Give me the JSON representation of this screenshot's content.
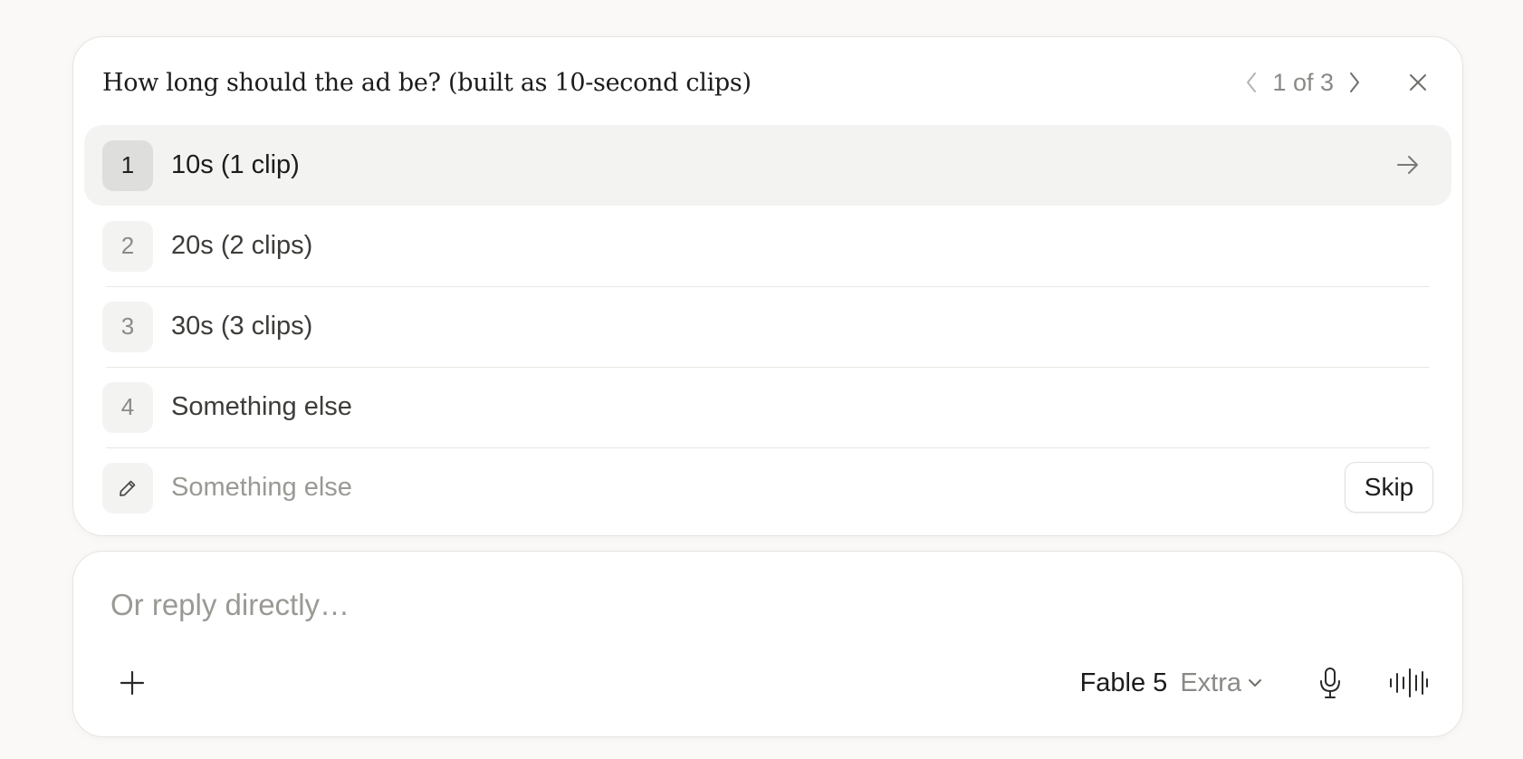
{
  "question": {
    "title": "How long should the ad be? (built as 10-second clips)",
    "pager": "1 of 3"
  },
  "options": [
    {
      "number": "1",
      "label": "10s (1 clip)"
    },
    {
      "number": "2",
      "label": "20s (2 clips)"
    },
    {
      "number": "3",
      "label": "30s (3 clips)"
    },
    {
      "number": "4",
      "label": "Something else"
    }
  ],
  "custom": {
    "placeholder": "Something else",
    "skip_label": "Skip"
  },
  "composer": {
    "placeholder": "Or reply directly…",
    "model_name": "Fable 5",
    "model_tier": "Extra"
  },
  "icons": {
    "prev": "chevron-left-icon",
    "next": "chevron-right-icon",
    "close": "close-icon",
    "submit": "arrow-right-icon",
    "edit": "pencil-icon",
    "add": "plus-icon",
    "dropdown": "chevron-down-icon",
    "mic": "microphone-icon",
    "voice": "voice-waveform-icon"
  },
  "colors": {
    "background": "#faf9f7",
    "card": "#ffffff",
    "active_row": "#f3f3f2",
    "muted_text": "#8a8985"
  }
}
